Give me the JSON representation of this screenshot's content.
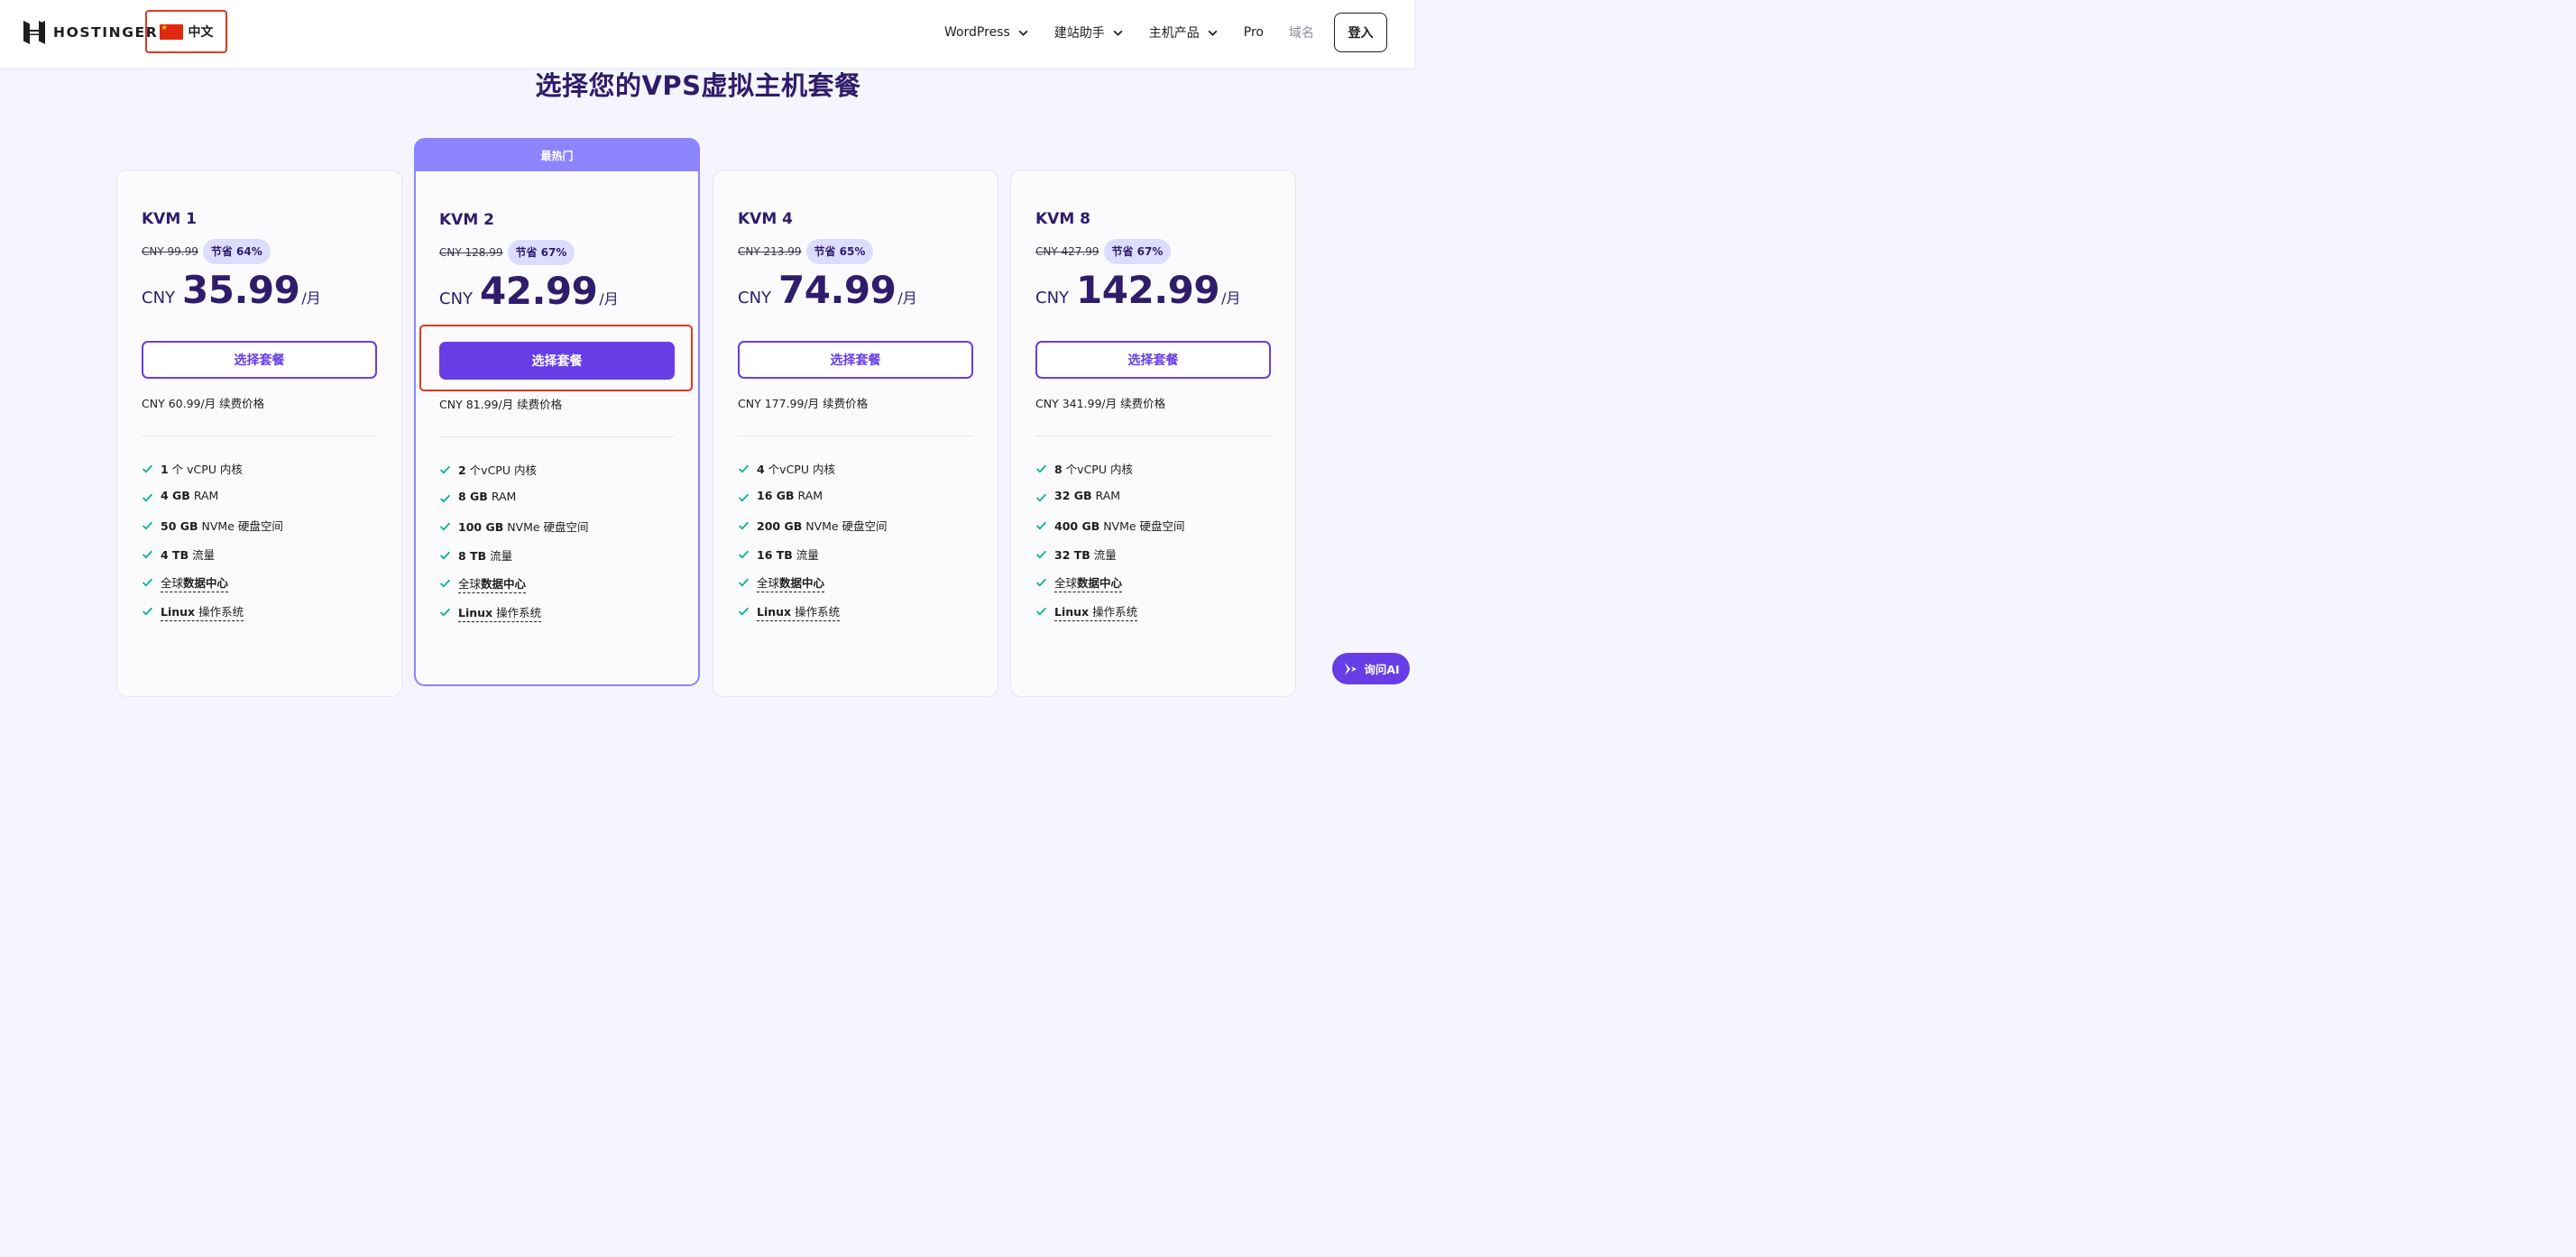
{
  "header": {
    "logo_text": "HOSTINGER",
    "language": {
      "flag": "china-flag-icon",
      "label": "中文"
    },
    "nav": [
      {
        "label": "WordPress",
        "has_dropdown": true
      },
      {
        "label": "建站助手",
        "has_dropdown": true
      },
      {
        "label": "主机产品",
        "has_dropdown": true
      },
      {
        "label": "Pro",
        "has_dropdown": false
      },
      {
        "label": "域名",
        "has_dropdown": false
      }
    ],
    "login_label": "登入"
  },
  "page_title": "选择您的VPS虚拟主机套餐",
  "plans": [
    {
      "name": "KVM 1",
      "old_price": "CNY 99.99",
      "save": "节省 64%",
      "currency": "CNY",
      "price": "35.99",
      "per": "/月",
      "button": "选择套餐",
      "renewal": "CNY 60.99/月 续费价格",
      "features": {
        "cpu": {
          "bold": "1",
          "text": " 个 vCPU 内核"
        },
        "ram": {
          "bold": "4 GB",
          "text": " RAM"
        },
        "disk": {
          "bold": "50 GB",
          "text": " NVMe 硬盘空间"
        },
        "bw": {
          "bold": "4 TB",
          "text": " 流量"
        },
        "dc": {
          "pre": "全球",
          "bold": "数据中心"
        },
        "os": {
          "bold": "Linux",
          "text": " 操作系统"
        }
      }
    },
    {
      "name": "KVM 2",
      "ribbon": "最热门",
      "old_price": "CNY 128.99",
      "save": "节省 67%",
      "currency": "CNY",
      "price": "42.99",
      "per": "/月",
      "button": "选择套餐",
      "renewal": "CNY 81.99/月 续费价格",
      "features": {
        "cpu": {
          "bold": "2",
          "text": " 个vCPU 内核"
        },
        "ram": {
          "bold": "8 GB",
          "text": " RAM"
        },
        "disk": {
          "bold": "100 GB",
          "text": " NVMe 硬盘空间"
        },
        "bw": {
          "bold": "8 TB",
          "text": " 流量"
        },
        "dc": {
          "pre": "全球",
          "bold": "数据中心"
        },
        "os": {
          "bold": "Linux",
          "text": " 操作系统"
        }
      }
    },
    {
      "name": "KVM 4",
      "old_price": "CNY 213.99",
      "save": "节省 65%",
      "currency": "CNY",
      "price": "74.99",
      "per": "/月",
      "button": "选择套餐",
      "renewal": "CNY 177.99/月 续费价格",
      "features": {
        "cpu": {
          "bold": "4",
          "text": " 个vCPU 内核"
        },
        "ram": {
          "bold": "16 GB",
          "text": " RAM"
        },
        "disk": {
          "bold": "200 GB",
          "text": " NVMe 硬盘空间"
        },
        "bw": {
          "bold": "16 TB",
          "text": " 流量"
        },
        "dc": {
          "pre": "全球",
          "bold": "数据中心"
        },
        "os": {
          "bold": "Linux",
          "text": " 操作系统"
        }
      }
    },
    {
      "name": "KVM 8",
      "old_price": "CNY 427.99",
      "save": "节省 67%",
      "currency": "CNY",
      "price": "142.99",
      "per": "/月",
      "button": "选择套餐",
      "renewal": "CNY 341.99/月 续费价格",
      "features": {
        "cpu": {
          "bold": "8",
          "text": " 个vCPU 内核"
        },
        "ram": {
          "bold": "32 GB",
          "text": " RAM"
        },
        "disk": {
          "bold": "400 GB",
          "text": " NVMe 硬盘空间"
        },
        "bw": {
          "bold": "32 TB",
          "text": " 流量"
        },
        "dc": {
          "pre": "全球",
          "bold": "数据中心"
        },
        "os": {
          "bold": "Linux",
          "text": " 操作系统"
        }
      }
    }
  ],
  "ask_ai_label": "询问AI",
  "colors": {
    "brand": "#673de6",
    "title": "#2f1c6a",
    "ribbon": "#8c85ff",
    "badge": "#dcdcff",
    "highlight": "#e3371e",
    "check": "#00b090"
  }
}
